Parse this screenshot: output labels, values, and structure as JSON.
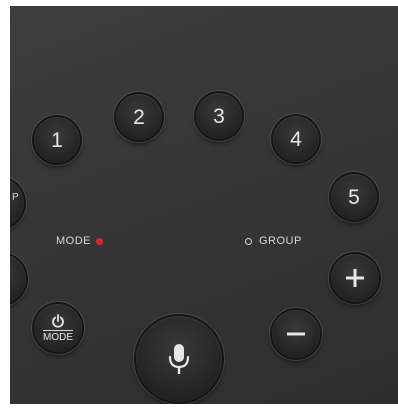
{
  "remote": {
    "numbers": [
      {
        "label": "1"
      },
      {
        "label": "2"
      },
      {
        "label": "3"
      },
      {
        "label": "4"
      },
      {
        "label": "5"
      }
    ],
    "mode_indicator": {
      "label": "MODE",
      "color": "#e02424"
    },
    "group_indicator": {
      "label": "GROUP"
    },
    "power_mode_button": {
      "label": "MODE",
      "icon": "power-icon"
    },
    "mic_button": {
      "icon": "microphone-icon"
    },
    "plus_button": {
      "icon": "plus-icon"
    },
    "minus_button": {
      "icon": "minus-icon"
    },
    "partial_left_text": "P"
  },
  "colors": {
    "panel": "#363636",
    "button": "#262626",
    "text": "#e6e6e6",
    "mode_dot": "#e02424"
  }
}
